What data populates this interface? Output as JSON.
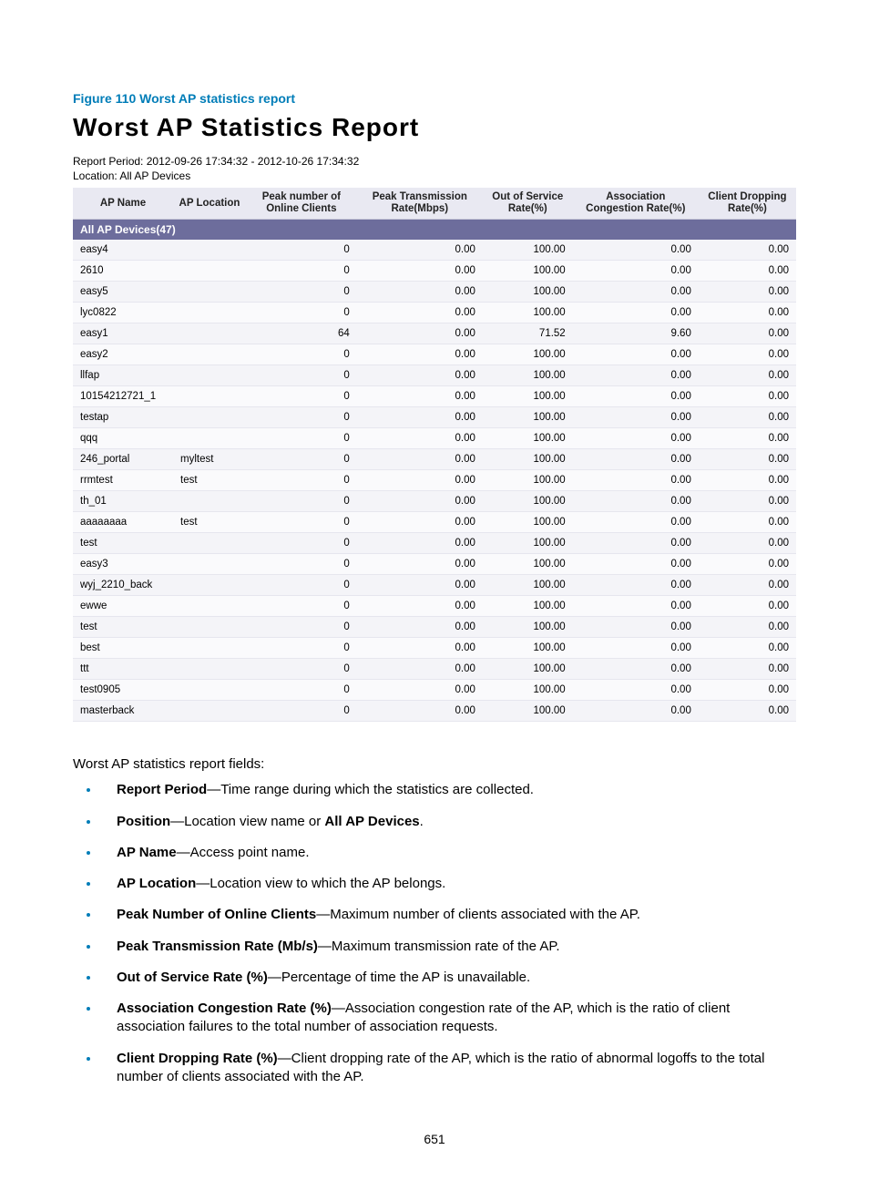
{
  "figure_caption": "Figure 110 Worst AP statistics report",
  "report_title": "Worst AP Statistics  Report",
  "report_period_label": "Report Period: ",
  "report_period_value": "2012-09-26 17:34:32  -  2012-10-26 17:34:32",
  "location_label": "Location: ",
  "location_value": "All AP Devices",
  "columns": {
    "ap_name": "AP Name",
    "ap_location": "AP Location",
    "peak_clients": "Peak number of Online Clients",
    "peak_rate": "Peak Transmission Rate(Mbps)",
    "oos": "Out of Service Rate(%)",
    "assoc": "Association Congestion Rate(%)",
    "drop": "Client Dropping Rate(%)"
  },
  "group_row": "All AP Devices(47)",
  "rows": [
    {
      "name": "easy4",
      "loc": "",
      "clients": "0",
      "rate": "0.00",
      "oos": "100.00",
      "assoc": "0.00",
      "drop": "0.00"
    },
    {
      "name": "2610",
      "loc": "",
      "clients": "0",
      "rate": "0.00",
      "oos": "100.00",
      "assoc": "0.00",
      "drop": "0.00"
    },
    {
      "name": "easy5",
      "loc": "",
      "clients": "0",
      "rate": "0.00",
      "oos": "100.00",
      "assoc": "0.00",
      "drop": "0.00"
    },
    {
      "name": "lyc0822",
      "loc": "",
      "clients": "0",
      "rate": "0.00",
      "oos": "100.00",
      "assoc": "0.00",
      "drop": "0.00"
    },
    {
      "name": "easy1",
      "loc": "",
      "clients": "64",
      "rate": "0.00",
      "oos": "71.52",
      "assoc": "9.60",
      "drop": "0.00"
    },
    {
      "name": "easy2",
      "loc": "",
      "clients": "0",
      "rate": "0.00",
      "oos": "100.00",
      "assoc": "0.00",
      "drop": "0.00"
    },
    {
      "name": "llfap",
      "loc": "",
      "clients": "0",
      "rate": "0.00",
      "oos": "100.00",
      "assoc": "0.00",
      "drop": "0.00"
    },
    {
      "name": "10154212721_1",
      "loc": "",
      "clients": "0",
      "rate": "0.00",
      "oos": "100.00",
      "assoc": "0.00",
      "drop": "0.00"
    },
    {
      "name": "testap",
      "loc": "",
      "clients": "0",
      "rate": "0.00",
      "oos": "100.00",
      "assoc": "0.00",
      "drop": "0.00"
    },
    {
      "name": "qqq",
      "loc": "",
      "clients": "0",
      "rate": "0.00",
      "oos": "100.00",
      "assoc": "0.00",
      "drop": "0.00"
    },
    {
      "name": "246_portal",
      "loc": "myltest",
      "clients": "0",
      "rate": "0.00",
      "oos": "100.00",
      "assoc": "0.00",
      "drop": "0.00"
    },
    {
      "name": "rrmtest",
      "loc": "test",
      "clients": "0",
      "rate": "0.00",
      "oos": "100.00",
      "assoc": "0.00",
      "drop": "0.00"
    },
    {
      "name": "th_01",
      "loc": "",
      "clients": "0",
      "rate": "0.00",
      "oos": "100.00",
      "assoc": "0.00",
      "drop": "0.00"
    },
    {
      "name": "aaaaaaaa",
      "loc": "test",
      "clients": "0",
      "rate": "0.00",
      "oos": "100.00",
      "assoc": "0.00",
      "drop": "0.00"
    },
    {
      "name": "test",
      "loc": "",
      "clients": "0",
      "rate": "0.00",
      "oos": "100.00",
      "assoc": "0.00",
      "drop": "0.00"
    },
    {
      "name": "easy3",
      "loc": "",
      "clients": "0",
      "rate": "0.00",
      "oos": "100.00",
      "assoc": "0.00",
      "drop": "0.00"
    },
    {
      "name": "wyj_2210_back",
      "loc": "",
      "clients": "0",
      "rate": "0.00",
      "oos": "100.00",
      "assoc": "0.00",
      "drop": "0.00"
    },
    {
      "name": "ewwe",
      "loc": "",
      "clients": "0",
      "rate": "0.00",
      "oos": "100.00",
      "assoc": "0.00",
      "drop": "0.00"
    },
    {
      "name": "test",
      "loc": "",
      "clients": "0",
      "rate": "0.00",
      "oos": "100.00",
      "assoc": "0.00",
      "drop": "0.00"
    },
    {
      "name": "best",
      "loc": "",
      "clients": "0",
      "rate": "0.00",
      "oos": "100.00",
      "assoc": "0.00",
      "drop": "0.00"
    },
    {
      "name": "ttt",
      "loc": "",
      "clients": "0",
      "rate": "0.00",
      "oos": "100.00",
      "assoc": "0.00",
      "drop": "0.00"
    },
    {
      "name": "test0905",
      "loc": "",
      "clients": "0",
      "rate": "0.00",
      "oos": "100.00",
      "assoc": "0.00",
      "drop": "0.00"
    },
    {
      "name": "masterback",
      "loc": "",
      "clients": "0",
      "rate": "0.00",
      "oos": "100.00",
      "assoc": "0.00",
      "drop": "0.00"
    }
  ],
  "fields_intro": "Worst AP statistics report fields:",
  "fields": [
    {
      "term": "Report Period",
      "desc": "—Time range during which the statistics are collected."
    },
    {
      "term": "Position",
      "desc_pre": "—Location view name or ",
      "desc_bold": "All AP Devices",
      "desc_post": "."
    },
    {
      "term": "AP Name",
      "desc": "—Access point name."
    },
    {
      "term": "AP Location",
      "desc": "—Location view to which the AP belongs."
    },
    {
      "term": "Peak Number of Online Clients",
      "desc": "—Maximum number of clients associated with the AP."
    },
    {
      "term": "Peak Transmission Rate (Mb/s)",
      "desc": "—Maximum transmission rate of the AP."
    },
    {
      "term": "Out of Service Rate (%)",
      "desc": "—Percentage of time the AP is unavailable."
    },
    {
      "term": "Association Congestion Rate (%)",
      "desc": "—Association congestion rate of the AP, which is the ratio of client association failures to the total number of association requests."
    },
    {
      "term": "Client Dropping Rate (%)",
      "desc": "—Client dropping rate of the AP, which is the ratio of abnormal logoffs to the total number of clients associated with the AP."
    }
  ],
  "page_number": "651"
}
